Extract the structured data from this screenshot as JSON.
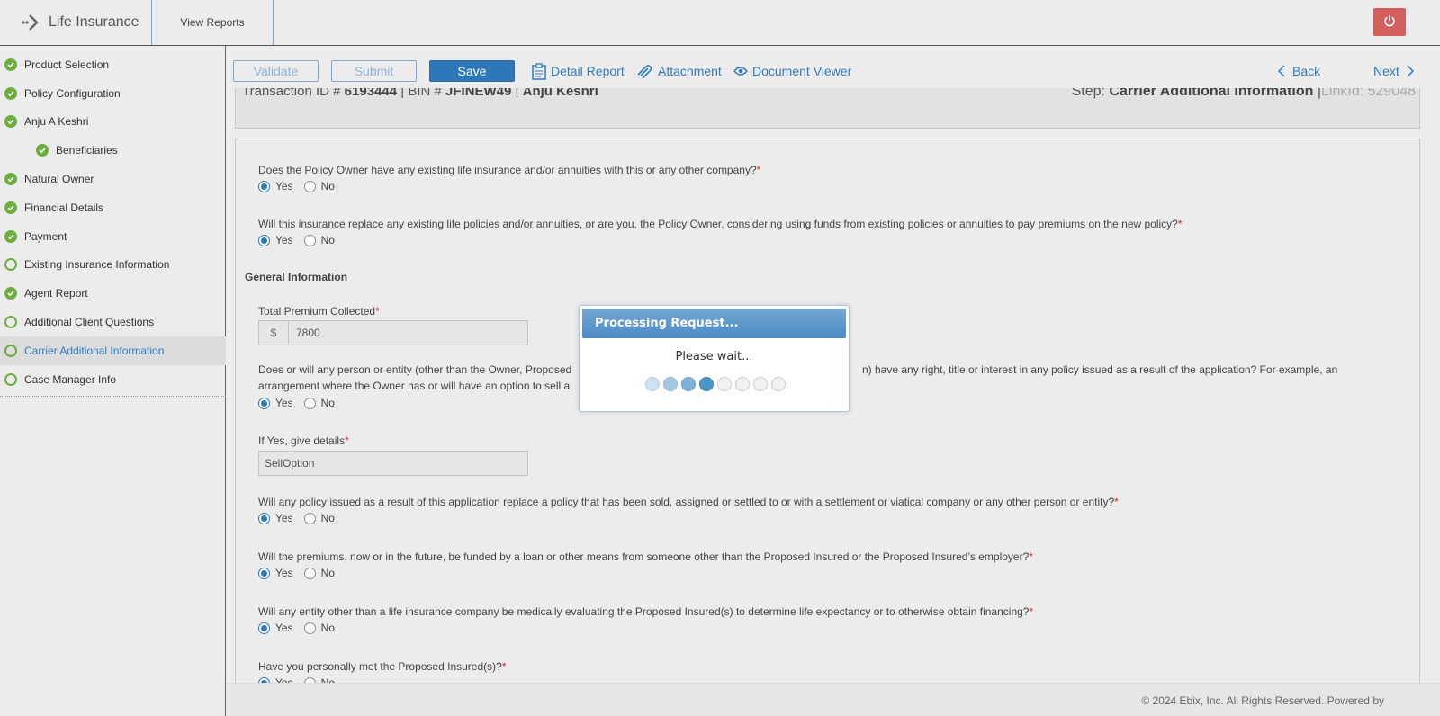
{
  "header": {
    "app_title": "Life Insurance",
    "view_reports": "View Reports",
    "power_icon": "power-icon",
    "power_color": "#d35f5f"
  },
  "sidebar": {
    "items": [
      {
        "label": "Product Selection",
        "status": "done"
      },
      {
        "label": "Policy Configuration",
        "status": "done"
      },
      {
        "label": "Anju A Keshri",
        "status": "done"
      },
      {
        "label": "Beneficiaries",
        "status": "done"
      },
      {
        "label": "Natural Owner",
        "status": "done"
      },
      {
        "label": "Financial Details",
        "status": "done"
      },
      {
        "label": "Payment",
        "status": "done"
      },
      {
        "label": "Existing Insurance Information",
        "status": "pending"
      },
      {
        "label": "Agent Report",
        "status": "done"
      },
      {
        "label": "Additional Client Questions",
        "status": "pending"
      },
      {
        "label": "Carrier Additional Information",
        "status": "pending",
        "active": true
      },
      {
        "label": "Case Manager Info",
        "status": "pending"
      }
    ]
  },
  "toolbar": {
    "validate": "Validate",
    "submit": "Submit",
    "save": "Save",
    "detail_report": "Detail Report",
    "attachment": "Attachment",
    "document_viewer": "Document Viewer",
    "back": "Back",
    "next": "Next"
  },
  "info": {
    "transaction_label": "Transaction ID #",
    "transaction_id": "6193444",
    "bin_label": "| BIN #",
    "bin": "JFINEW49",
    "name_sep": "|",
    "name": "Anju Keshri",
    "step_label": "Step:",
    "step": "Carrier Additional Information",
    "linkid_sep": "|",
    "linkid": "LinkId: 529048"
  },
  "form": {
    "yes": "Yes",
    "no": "No",
    "q1": "Does the Policy Owner have any existing life insurance and/or annuities with this or any other company?",
    "q2": "Will this insurance replace any existing life policies and/or annuities, or are you, the Policy Owner, considering using funds from existing policies or annuities to pay premiums on the new policy?",
    "general_info": "General Information",
    "premium_label": "Total Premium Collected",
    "currency": "$",
    "premium_value": "7800",
    "q3_line1_a": "Does or will any person or entity (other than the Owner, Proposed",
    "q3_line1_b": "n) have any right, title or interest in any policy issued as a result of the application? For example, an",
    "q3_line2": "arrangement where the Owner has or will have an option to sell a",
    "details_label": "If Yes, give details",
    "details_value": "SellOption",
    "q4": "Will any policy issued as a result of this application replace a policy that has been sold, assigned or settled to or with a settlement or viatical company or any other person or entity?",
    "q5": "Will the premiums, now or in the future, be funded by a loan or other means from someone other than the Proposed Insured or the Proposed Insured’s employer?",
    "q6": "Will any entity other than a life insurance company be medically evaluating the Proposed Insured(s) to determine life expectancy or to otherwise obtain financing?",
    "q7": "Have you personally met the Proposed Insured(s)?"
  },
  "modal": {
    "title": "Processing Request...",
    "message": "Please wait..."
  },
  "footer": {
    "copyright": "© 2024 Ebix, Inc. All Rights Reserved. Powered by"
  },
  "colors": {
    "accent": "#2f78b8",
    "success": "#6cae3e",
    "required": "#d9262b"
  }
}
